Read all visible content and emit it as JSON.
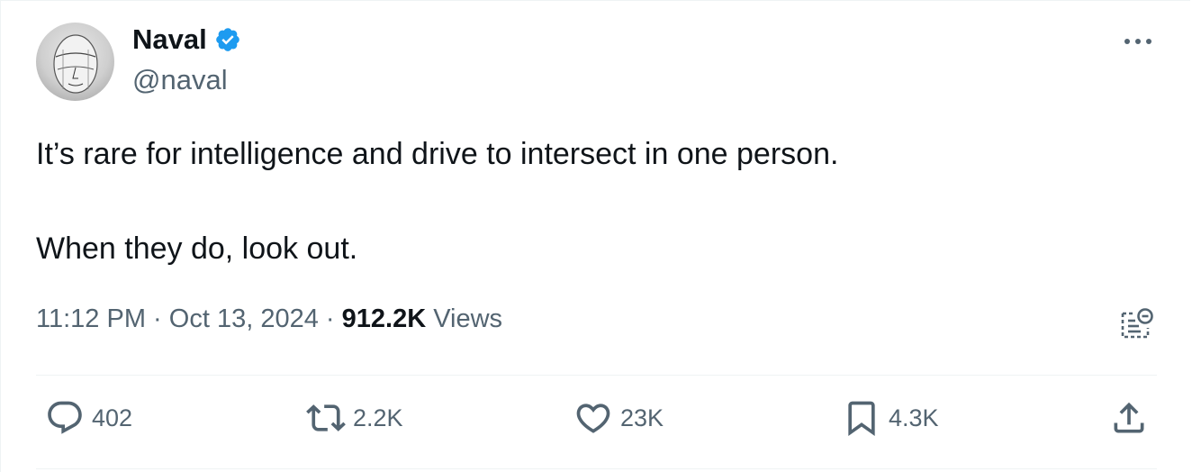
{
  "author": {
    "name": "Naval",
    "handle": "@naval",
    "verified_icon": "verified-badge-icon",
    "verified_color": "#1d9bf0"
  },
  "tweet": {
    "lines": [
      "It’s rare for intelligence and drive to intersect in one person.",
      "When they do, look out."
    ],
    "time": "11:12 PM",
    "separator": "·",
    "date": "Oct 13, 2024",
    "views_count": "912.2K",
    "views_label": "Views"
  },
  "actions": {
    "replies": "402",
    "reposts": "2.2K",
    "likes": "23K",
    "bookmarks": "4.3K"
  },
  "icons": {
    "more": "more-dots-icon",
    "notes": "community-notes-icon",
    "reply": "reply-icon",
    "repost": "repost-icon",
    "like": "heart-icon",
    "bookmark": "bookmark-icon",
    "share": "share-icon"
  },
  "colors": {
    "text_primary": "#0f1419",
    "text_secondary": "#536471",
    "divider": "#eff3f4"
  }
}
